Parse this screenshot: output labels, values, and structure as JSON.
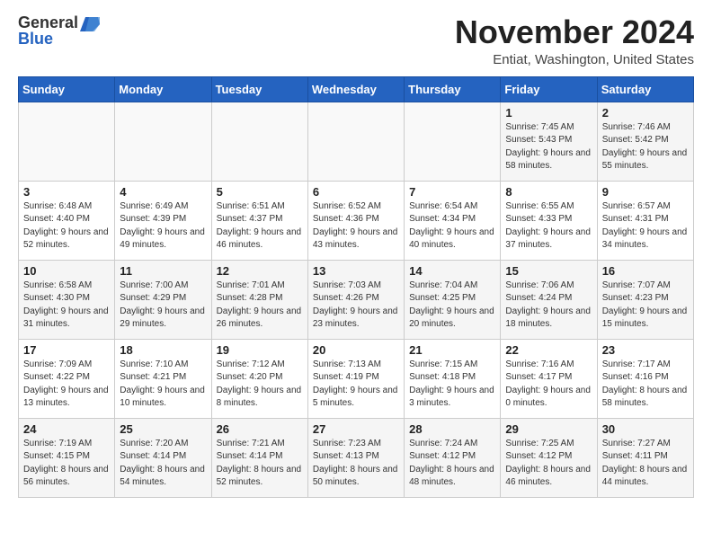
{
  "header": {
    "logo_general": "General",
    "logo_blue": "Blue",
    "month_title": "November 2024",
    "location": "Entiat, Washington, United States"
  },
  "days_of_week": [
    "Sunday",
    "Monday",
    "Tuesday",
    "Wednesday",
    "Thursday",
    "Friday",
    "Saturday"
  ],
  "weeks": [
    [
      {
        "day": "",
        "info": ""
      },
      {
        "day": "",
        "info": ""
      },
      {
        "day": "",
        "info": ""
      },
      {
        "day": "",
        "info": ""
      },
      {
        "day": "",
        "info": ""
      },
      {
        "day": "1",
        "info": "Sunrise: 7:45 AM\nSunset: 5:43 PM\nDaylight: 9 hours and 58 minutes."
      },
      {
        "day": "2",
        "info": "Sunrise: 7:46 AM\nSunset: 5:42 PM\nDaylight: 9 hours and 55 minutes."
      }
    ],
    [
      {
        "day": "3",
        "info": "Sunrise: 6:48 AM\nSunset: 4:40 PM\nDaylight: 9 hours and 52 minutes."
      },
      {
        "day": "4",
        "info": "Sunrise: 6:49 AM\nSunset: 4:39 PM\nDaylight: 9 hours and 49 minutes."
      },
      {
        "day": "5",
        "info": "Sunrise: 6:51 AM\nSunset: 4:37 PM\nDaylight: 9 hours and 46 minutes."
      },
      {
        "day": "6",
        "info": "Sunrise: 6:52 AM\nSunset: 4:36 PM\nDaylight: 9 hours and 43 minutes."
      },
      {
        "day": "7",
        "info": "Sunrise: 6:54 AM\nSunset: 4:34 PM\nDaylight: 9 hours and 40 minutes."
      },
      {
        "day": "8",
        "info": "Sunrise: 6:55 AM\nSunset: 4:33 PM\nDaylight: 9 hours and 37 minutes."
      },
      {
        "day": "9",
        "info": "Sunrise: 6:57 AM\nSunset: 4:31 PM\nDaylight: 9 hours and 34 minutes."
      }
    ],
    [
      {
        "day": "10",
        "info": "Sunrise: 6:58 AM\nSunset: 4:30 PM\nDaylight: 9 hours and 31 minutes."
      },
      {
        "day": "11",
        "info": "Sunrise: 7:00 AM\nSunset: 4:29 PM\nDaylight: 9 hours and 29 minutes."
      },
      {
        "day": "12",
        "info": "Sunrise: 7:01 AM\nSunset: 4:28 PM\nDaylight: 9 hours and 26 minutes."
      },
      {
        "day": "13",
        "info": "Sunrise: 7:03 AM\nSunset: 4:26 PM\nDaylight: 9 hours and 23 minutes."
      },
      {
        "day": "14",
        "info": "Sunrise: 7:04 AM\nSunset: 4:25 PM\nDaylight: 9 hours and 20 minutes."
      },
      {
        "day": "15",
        "info": "Sunrise: 7:06 AM\nSunset: 4:24 PM\nDaylight: 9 hours and 18 minutes."
      },
      {
        "day": "16",
        "info": "Sunrise: 7:07 AM\nSunset: 4:23 PM\nDaylight: 9 hours and 15 minutes."
      }
    ],
    [
      {
        "day": "17",
        "info": "Sunrise: 7:09 AM\nSunset: 4:22 PM\nDaylight: 9 hours and 13 minutes."
      },
      {
        "day": "18",
        "info": "Sunrise: 7:10 AM\nSunset: 4:21 PM\nDaylight: 9 hours and 10 minutes."
      },
      {
        "day": "19",
        "info": "Sunrise: 7:12 AM\nSunset: 4:20 PM\nDaylight: 9 hours and 8 minutes."
      },
      {
        "day": "20",
        "info": "Sunrise: 7:13 AM\nSunset: 4:19 PM\nDaylight: 9 hours and 5 minutes."
      },
      {
        "day": "21",
        "info": "Sunrise: 7:15 AM\nSunset: 4:18 PM\nDaylight: 9 hours and 3 minutes."
      },
      {
        "day": "22",
        "info": "Sunrise: 7:16 AM\nSunset: 4:17 PM\nDaylight: 9 hours and 0 minutes."
      },
      {
        "day": "23",
        "info": "Sunrise: 7:17 AM\nSunset: 4:16 PM\nDaylight: 8 hours and 58 minutes."
      }
    ],
    [
      {
        "day": "24",
        "info": "Sunrise: 7:19 AM\nSunset: 4:15 PM\nDaylight: 8 hours and 56 minutes."
      },
      {
        "day": "25",
        "info": "Sunrise: 7:20 AM\nSunset: 4:14 PM\nDaylight: 8 hours and 54 minutes."
      },
      {
        "day": "26",
        "info": "Sunrise: 7:21 AM\nSunset: 4:14 PM\nDaylight: 8 hours and 52 minutes."
      },
      {
        "day": "27",
        "info": "Sunrise: 7:23 AM\nSunset: 4:13 PM\nDaylight: 8 hours and 50 minutes."
      },
      {
        "day": "28",
        "info": "Sunrise: 7:24 AM\nSunset: 4:12 PM\nDaylight: 8 hours and 48 minutes."
      },
      {
        "day": "29",
        "info": "Sunrise: 7:25 AM\nSunset: 4:12 PM\nDaylight: 8 hours and 46 minutes."
      },
      {
        "day": "30",
        "info": "Sunrise: 7:27 AM\nSunset: 4:11 PM\nDaylight: 8 hours and 44 minutes."
      }
    ]
  ]
}
